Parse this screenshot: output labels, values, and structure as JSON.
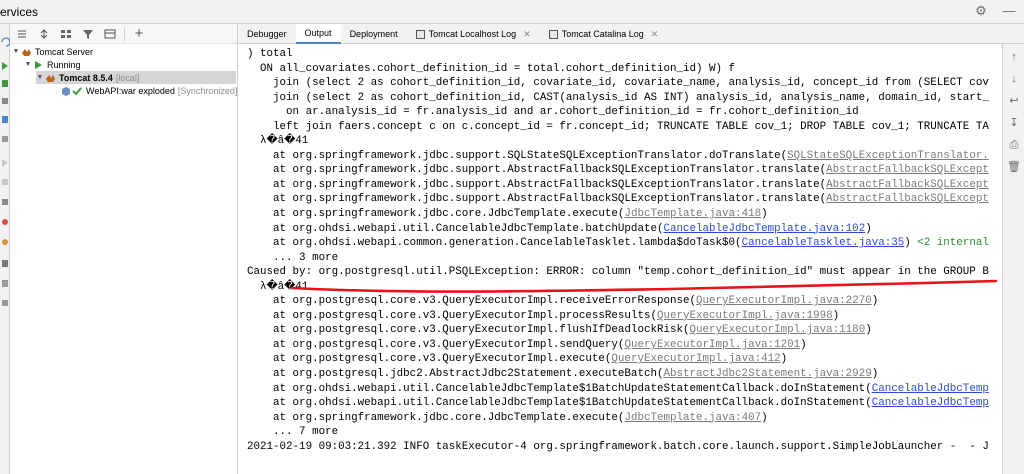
{
  "window": {
    "title": "ervices"
  },
  "tree": {
    "items": [
      {
        "label": "Tomcat Server",
        "suffix": ""
      },
      {
        "label": "Running",
        "suffix": ""
      },
      {
        "label": "Tomcat 8.5.4",
        "suffix": "[local]"
      },
      {
        "label": "WebAPI:war exploded",
        "suffix": "[Synchronized]"
      }
    ]
  },
  "tabs": [
    {
      "label": "Debugger"
    },
    {
      "label": "Output"
    },
    {
      "label": "Deployment"
    },
    {
      "label": "Tomcat Localhost Log"
    },
    {
      "label": "Tomcat Catalina Log"
    }
  ],
  "console": {
    "lines": [
      {
        "text": ") total"
      },
      {
        "text": "  ON all_covariates.cohort_definition_id = total.cohort_definition_id) W) f"
      },
      {
        "text": "    join (select 2 as cohort_definition_id, covariate_id, covariate_name, analysis_id, concept_id from (SELECT cov"
      },
      {
        "text": "    join (select 2 as cohort_definition_id, CAST(analysis_id AS INT) analysis_id, analysis_name, domain_id, start_"
      },
      {
        "text": "      on ar.analysis_id = fr.analysis_id and ar.cohort_definition_id = fr.cohort_definition_id"
      },
      {
        "text": "    left join faers.concept c on c.concept_id = fr.concept_id; TRUNCATE TABLE cov_1; DROP TABLE cov_1; TRUNCATE TA"
      },
      {
        "text": "  λ�â�41"
      },
      {
        "prefix": "    at org.springframework.jdbc.support.SQLStateSQLExceptionTranslator.doTranslate(",
        "link": "SQLStateSQLExceptionTranslator.",
        "grey": true
      },
      {
        "prefix": "    at org.springframework.jdbc.support.AbstractFallbackSQLExceptionTranslator.translate(",
        "link": "AbstractFallbackSQLExcept",
        "grey": true
      },
      {
        "prefix": "    at org.springframework.jdbc.support.AbstractFallbackSQLExceptionTranslator.translate(",
        "link": "AbstractFallbackSQLExcept",
        "grey": true
      },
      {
        "prefix": "    at org.springframework.jdbc.support.AbstractFallbackSQLExceptionTranslator.translate(",
        "link": "AbstractFallbackSQLExcept",
        "grey": true
      },
      {
        "prefix": "    at org.springframework.jdbc.core.JdbcTemplate.execute(",
        "link": "JdbcTemplate.java:418",
        "suffix": ")",
        "grey": true
      },
      {
        "prefix": "    at org.ohdsi.webapi.util.CancelableJdbcTemplate.batchUpdate(",
        "link": "CancelableJdbcTemplate.java:102",
        "suffix": ")",
        "grey": false
      },
      {
        "prefix": "    at org.ohdsi.webapi.common.generation.CancelableTasklet.lambda$doTask$0(",
        "link": "CancelableTasklet.java:35",
        "suffix": ") ",
        "internal": "<2 internal",
        "grey": false
      },
      {
        "text": "    ... 3 more"
      },
      {
        "text": "Caused by: org.postgresql.util.PSQLException: ERROR: column \"temp.cohort_definition_id\" must appear in the GROUP B"
      },
      {
        "text": "  λ�â�41"
      },
      {
        "prefix": "    at org.postgresql.core.v3.QueryExecutorImpl.receiveErrorResponse(",
        "link": "QueryExecutorImpl.java:2270",
        "suffix": ")",
        "grey": true
      },
      {
        "prefix": "    at org.postgresql.core.v3.QueryExecutorImpl.processResults(",
        "link": "QueryExecutorImpl.java:1998",
        "suffix": ")",
        "grey": true
      },
      {
        "prefix": "    at org.postgresql.core.v3.QueryExecutorImpl.flushIfDeadlockRisk(",
        "link": "QueryExecutorImpl.java:1180",
        "suffix": ")",
        "grey": true
      },
      {
        "prefix": "    at org.postgresql.core.v3.QueryExecutorImpl.sendQuery(",
        "link": "QueryExecutorImpl.java:1201",
        "suffix": ")",
        "grey": true
      },
      {
        "prefix": "    at org.postgresql.core.v3.QueryExecutorImpl.execute(",
        "link": "QueryExecutorImpl.java:412",
        "suffix": ")",
        "grey": true
      },
      {
        "prefix": "    at org.postgresql.jdbc2.AbstractJdbc2Statement.executeBatch(",
        "link": "AbstractJdbc2Statement.java:2929",
        "suffix": ")",
        "grey": true
      },
      {
        "prefix": "    at org.ohdsi.webapi.util.CancelableJdbcTemplate$1BatchUpdateStatementCallback.doInStatement(",
        "link": "CancelableJdbcTemp",
        "grey": false
      },
      {
        "prefix": "    at org.ohdsi.webapi.util.CancelableJdbcTemplate$1BatchUpdateStatementCallback.doInStatement(",
        "link": "CancelableJdbcTemp",
        "grey": false
      },
      {
        "prefix": "    at org.springframework.jdbc.core.JdbcTemplate.execute(",
        "link": "JdbcTemplate.java:407",
        "suffix": ")",
        "grey": true
      },
      {
        "text": "    ... 7 more"
      },
      {
        "text": "2021-02-19 09:03:21.392 INFO taskExecutor-4 org.springframework.batch.core.launch.support.SimpleJobLauncher -  - J"
      }
    ]
  },
  "colors": {
    "link_blue": "#2a4bd2",
    "link_grey": "#7a7a7a",
    "annotation_red": "#e8141a",
    "running_green": "#3c9a3c",
    "active_tab_underline": "#4a88c7"
  }
}
